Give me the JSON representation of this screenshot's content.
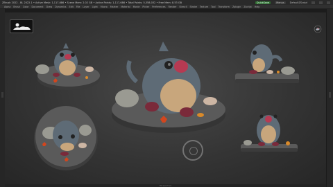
{
  "app": {
    "title": "ZBrush 2022 - BL 2022.1 • Active Mesh: 1,117,686 • Scene Mem: 2.02 GB • Active Points: 1,117,686 • Total Points: 5,358,032 • Free Mem: 8.53 GB",
    "status_badge": "QuickSave",
    "menu_badge": "Menus",
    "default_script": "DefaultZScript"
  },
  "menus": [
    "Alpha",
    "Brush",
    "Color",
    "Document",
    "Draw",
    "Dynamics",
    "Edit",
    "File",
    "Layer",
    "Light",
    "Macro",
    "Marker",
    "Material",
    "Movie",
    "Picker",
    "Preferences",
    "Render",
    "Stencil",
    "Stroke",
    "Texture",
    "Tool",
    "Transform",
    "Zplugin",
    "Zscript",
    "Help"
  ],
  "viewport": {
    "bottom_label": "Perspective"
  },
  "colors": {
    "shark_body": "#5e6b76",
    "shark_belly": "#c8a67c",
    "mouth": "#b63a52",
    "base": "#5a5a5a",
    "starfish": "#d2461e",
    "rock": "#9a9a92"
  },
  "icons": [
    "stage-icon",
    "logo-icon",
    "gizmo-icon"
  ]
}
